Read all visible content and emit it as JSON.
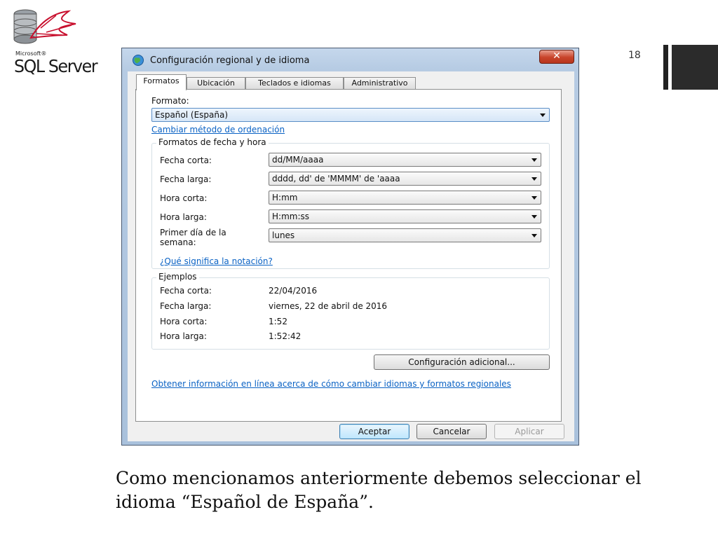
{
  "slide": {
    "logo_microsoft": "Microsoft®",
    "logo_product": "SQL Server",
    "page_number": "18",
    "caption": "Como mencionamos anteriormente debemos seleccionar el idioma “Español de España”."
  },
  "window": {
    "title": "Configuración regional y de idioma",
    "close_label": "✕"
  },
  "tabs": [
    {
      "label": "Formatos",
      "active": true
    },
    {
      "label": "Ubicación",
      "active": false
    },
    {
      "label": "Teclados e idiomas",
      "active": false
    },
    {
      "label": "Administrativo",
      "active": false
    }
  ],
  "formato": {
    "label": "Formato:",
    "value": "Español (España)",
    "sort_link": "Cambiar método de ordenación"
  },
  "date_time_formats": {
    "legend": "Formatos de fecha y hora",
    "rows": [
      {
        "label": "Fecha corta:",
        "value": "dd/MM/aaaa"
      },
      {
        "label": "Fecha larga:",
        "value": "dddd, dd' de 'MMMM' de 'aaaa"
      },
      {
        "label": "Hora corta:",
        "value": "H:mm"
      },
      {
        "label": "Hora larga:",
        "value": "H:mm:ss"
      },
      {
        "label": "Primer día de la semana:",
        "value": "lunes"
      }
    ],
    "notation_link": "¿Qué significa la notación?"
  },
  "examples": {
    "legend": "Ejemplos",
    "rows": [
      {
        "label": "Fecha corta:",
        "value": "22/04/2016"
      },
      {
        "label": "Fecha larga:",
        "value": "viernes, 22 de abril de 2016"
      },
      {
        "label": "Hora corta:",
        "value": "1:52"
      },
      {
        "label": "Hora larga:",
        "value": "1:52:42"
      }
    ]
  },
  "additional_settings_button": "Configuración adicional...",
  "online_info_link": "Obtener información en línea acerca de cómo cambiar idiomas y formatos regionales",
  "footer_buttons": {
    "ok": "Aceptar",
    "cancel": "Cancelar",
    "apply": "Aplicar"
  },
  "colors": {
    "link": "#0a62c4",
    "close_button": "#c8442a",
    "title_bar": "#b6cbe3"
  }
}
